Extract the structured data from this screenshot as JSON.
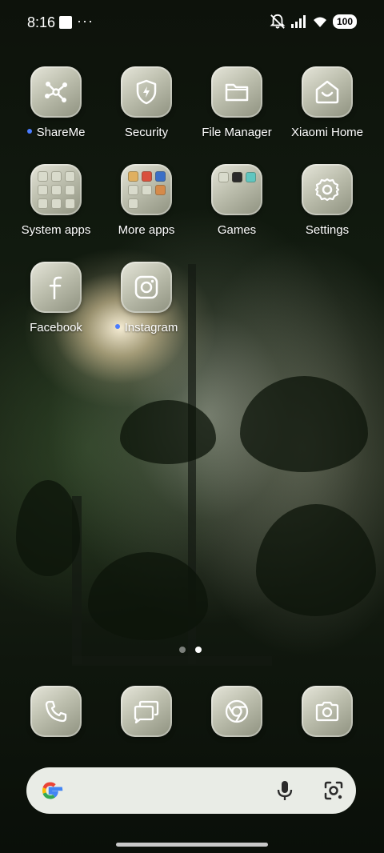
{
  "status_bar": {
    "time": "8:16",
    "more": "···",
    "battery": "100"
  },
  "apps": [
    {
      "label": "ShareMe",
      "icon": "share-network-icon",
      "has_new_dot": true
    },
    {
      "label": "Security",
      "icon": "shield-bolt-icon",
      "has_new_dot": false
    },
    {
      "label": "File Manager",
      "icon": "folder-icon",
      "has_new_dot": false
    },
    {
      "label": "Xiaomi Home",
      "icon": "smart-home-icon",
      "has_new_dot": false
    },
    {
      "label": "System apps",
      "icon": "folder-grid-icon",
      "has_new_dot": false
    },
    {
      "label": "More apps",
      "icon": "folder-grid-icon",
      "has_new_dot": false
    },
    {
      "label": "Games",
      "icon": "folder-grid-icon",
      "has_new_dot": false
    },
    {
      "label": "Settings",
      "icon": "gear-icon",
      "has_new_dot": false
    },
    {
      "label": "Facebook",
      "icon": "facebook-icon",
      "has_new_dot": false
    },
    {
      "label": "Instagram",
      "icon": "instagram-icon",
      "has_new_dot": true
    }
  ],
  "pager": {
    "pages": 2,
    "active": 2
  },
  "dock": [
    {
      "name": "phone",
      "icon": "phone-icon"
    },
    {
      "name": "messages",
      "icon": "messages-icon"
    },
    {
      "name": "chrome",
      "icon": "chrome-icon"
    },
    {
      "name": "camera",
      "icon": "camera-icon"
    }
  ],
  "search_bar": {
    "google_icon": "google-logo-icon",
    "mic_icon": "microphone-icon",
    "lens_icon": "google-lens-icon"
  },
  "colors": {
    "notification_dot": "#4a7cff",
    "icon_tile": "#bdbfae"
  }
}
